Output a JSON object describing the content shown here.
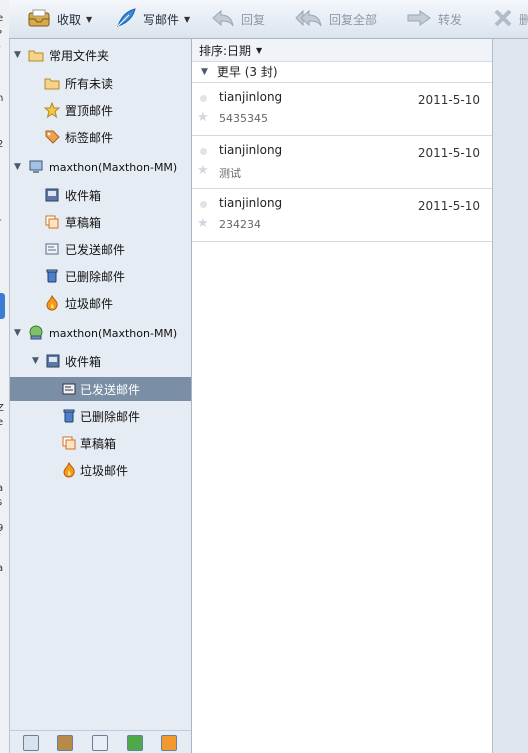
{
  "toolbar": {
    "receive": "收取",
    "compose": "写邮件",
    "reply": "回复",
    "reply_all": "回复全部",
    "forward": "转发",
    "delete": "删"
  },
  "left_edge_chars": [
    "e",
    "?",
    "/",
    "n",
    "2",
    "r",
    "i",
    "Z",
    "e",
    "a",
    "s",
    "9",
    "a"
  ],
  "sidebar": {
    "favorites": {
      "label": "常用文件夹",
      "items": [
        {
          "label": "所有未读",
          "icon": "folder-icon"
        },
        {
          "label": "置顶邮件",
          "icon": "star-icon"
        },
        {
          "label": "标签邮件",
          "icon": "tag-icon"
        }
      ]
    },
    "account1": {
      "label": "maxthon(Maxthon-MM)",
      "items": [
        {
          "label": "收件箱",
          "icon": "inbox-icon"
        },
        {
          "label": "草稿箱",
          "icon": "drafts-icon"
        },
        {
          "label": "已发送邮件",
          "icon": "sent-icon"
        },
        {
          "label": "已删除邮件",
          "icon": "trash-icon"
        },
        {
          "label": "垃圾邮件",
          "icon": "junk-icon"
        }
      ]
    },
    "account2": {
      "label": "maxthon(Maxthon-MM)",
      "inbox": "收件箱",
      "items": [
        {
          "label": "已发送邮件",
          "icon": "sent-icon"
        },
        {
          "label": "已删除邮件",
          "icon": "trash-icon"
        },
        {
          "label": "草稿箱",
          "icon": "drafts-icon"
        },
        {
          "label": "垃圾邮件",
          "icon": "junk-icon"
        }
      ]
    }
  },
  "list": {
    "sort_label": "排序:日期",
    "group_label": "更早 (3 封)",
    "messages": [
      {
        "from": "tianjinlong",
        "date": "2011-5-10",
        "preview": "5435345"
      },
      {
        "from": "tianjinlong",
        "date": "2011-5-10",
        "preview": "测试"
      },
      {
        "from": "tianjinlong",
        "date": "2011-5-10",
        "preview": "234234"
      }
    ]
  },
  "colors": {
    "selected_bg": "#7a8ea6",
    "sidebar_bg": "#e6ecf3",
    "toolbar_bg": "#dbe4ee"
  }
}
